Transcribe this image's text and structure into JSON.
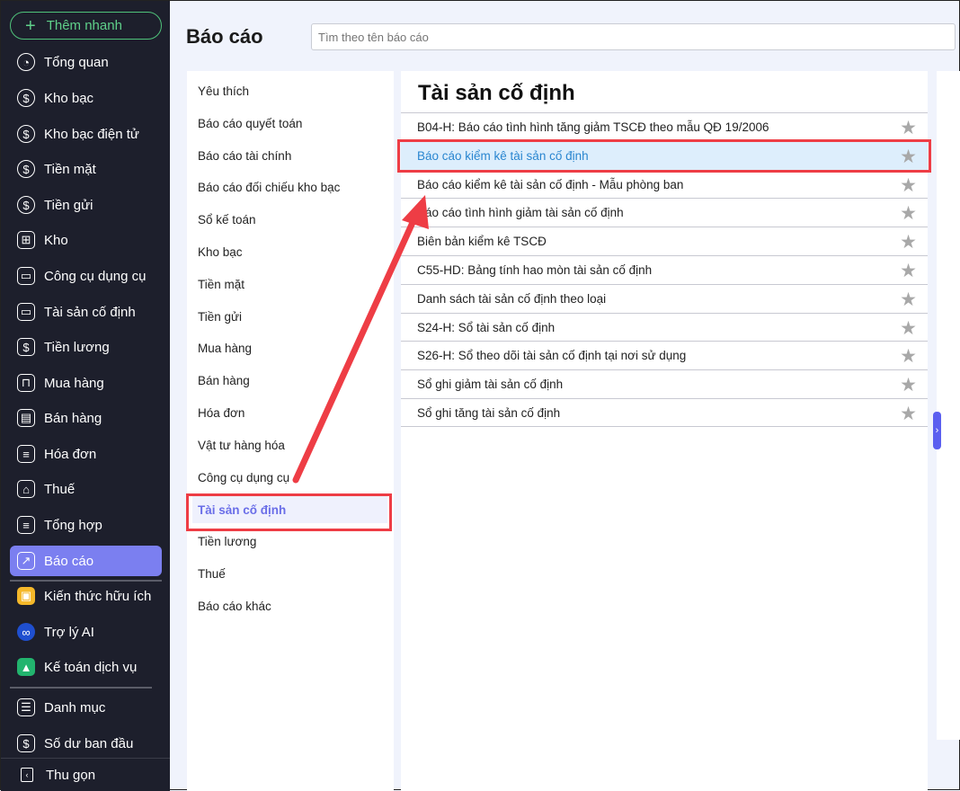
{
  "sidebar": {
    "quick_add": "Thêm nhanh",
    "items": [
      {
        "label": "Tổng quan",
        "icon": "◔"
      },
      {
        "label": "Kho bạc",
        "icon": "$"
      },
      {
        "label": "Kho bạc điện tử",
        "icon": "$"
      },
      {
        "label": "Tiền mặt",
        "icon": "$"
      },
      {
        "label": "Tiền gửi",
        "icon": "$"
      },
      {
        "label": "Kho",
        "icon": "⊞"
      },
      {
        "label": "Công cụ dụng cụ",
        "icon": "▭"
      },
      {
        "label": "Tài sản cố định",
        "icon": "▭"
      },
      {
        "label": "Tiền lương",
        "icon": "$"
      },
      {
        "label": "Mua hàng",
        "icon": "⊓"
      },
      {
        "label": "Bán hàng",
        "icon": "▤"
      },
      {
        "label": "Hóa đơn",
        "icon": "≡"
      },
      {
        "label": "Thuế",
        "icon": "⌂"
      },
      {
        "label": "Tổng hợp",
        "icon": "≡"
      },
      {
        "label": "Báo cáo",
        "icon": "↗"
      },
      {
        "label": "Kiến thức hữu ích",
        "icon": "▣"
      },
      {
        "label": "Trợ lý AI",
        "icon": "∞"
      },
      {
        "label": "Kế toán dịch vụ",
        "icon": "▲"
      },
      {
        "label": "Danh mục",
        "icon": "☰"
      },
      {
        "label": "Số dư ban đầu",
        "icon": "$"
      }
    ],
    "collapse": "Thu gọn"
  },
  "header": {
    "title": "Báo cáo",
    "search_placeholder": "Tìm theo tên báo cáo"
  },
  "categories": [
    "Yêu thích",
    "Báo cáo quyết toán",
    "Báo cáo tài chính",
    "Báo cáo đối chiếu kho bạc",
    "Sổ kế toán",
    "Kho bạc",
    "Tiền mặt",
    "Tiền gửi",
    "Mua hàng",
    "Bán hàng",
    "Hóa đơn",
    "Vật tư hàng hóa",
    "Công cụ dụng cụ",
    "Tài sản cố định",
    "Tiền lương",
    "Thuế",
    "Báo cáo khác"
  ],
  "selected_category": "Tài sản cố định",
  "reports": {
    "title": "Tài sản cố định",
    "items": [
      "B04-H: Báo cáo tình hình tăng giảm TSCĐ theo mẫu QĐ 19/2006",
      "Báo cáo kiểm kê tài sản cố định",
      "Báo cáo kiểm kê tài sản cố định - Mẫu phòng ban",
      "Báo cáo tình hình giảm tài sản cố định",
      "Biên bản kiểm kê TSCĐ",
      "C55-HD: Bảng tính hao mòn tài sản cố định",
      "Danh sách tài sản cố định theo loại",
      "S24-H: Sổ tài sản cố định",
      "S26-H: Sổ theo dõi tài sản cố định tại nơi sử dụng",
      "Sổ ghi giảm tài sản cố định",
      "Sổ ghi tăng tài sản cố định"
    ]
  },
  "colors": {
    "sidebar": "#1d1f2c",
    "accent": "#7b7ff0",
    "highlight": "#ee3d45",
    "selected_row": "#ddeefc"
  }
}
